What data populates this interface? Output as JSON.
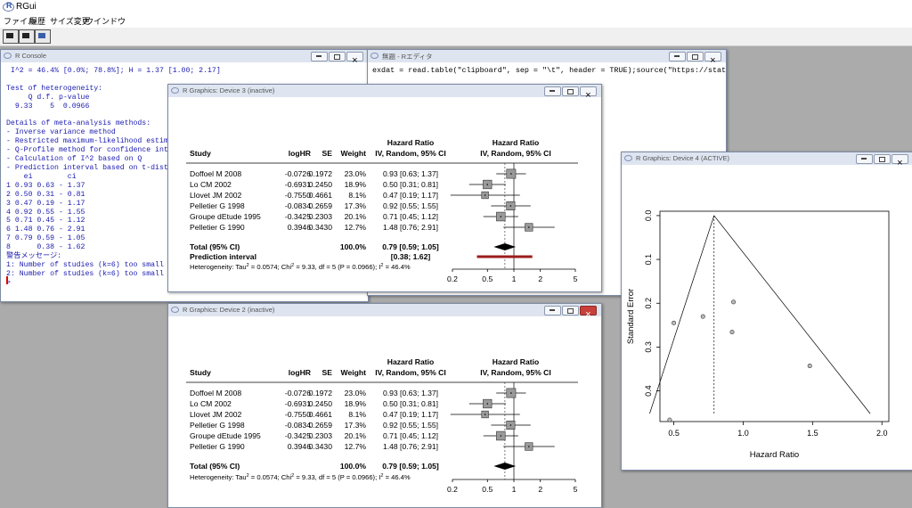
{
  "app": {
    "title": "RGui"
  },
  "menu": [
    "ファイル",
    "履歴",
    "サイズ変更",
    "ウインドウ"
  ],
  "toolbar": {
    "icons": [
      "open-script-icon",
      "print-icon",
      "console-icon"
    ]
  },
  "console": {
    "title": "R Console",
    "lines": [
      " I^2 = 46.4% [0.0%; 78.8%]; H = 1.37 [1.00; 2.17]",
      "",
      "Test of heterogeneity:",
      "     Q d.f. p-value",
      "  9.33    5  0.0966",
      "",
      "Details of meta-analysis methods:",
      "- Inverse variance method",
      "- Restricted maximum-likelihood estim",
      "- Q-Profile method for confidence int",
      "- Calculation of I^2 based on Q",
      "- Prediction interval based on t-dist",
      "    ei        ci",
      "1 0.93 0.63 - 1.37",
      "2 0.50 0.31 - 0.81",
      "3 0.47 0.19 - 1.17",
      "4 0.92 0.55 - 1.55",
      "5 0.71 0.45 - 1.12",
      "6 1.48 0.76 - 2.91",
      "7 0.79 0.59 - 1.05",
      "8      0.38 - 1.62",
      "警告メッセージ:",
      "1: Number of studies (k=6) too small",
      "2: Number of studies (k=6) too small",
      "> "
    ]
  },
  "editor": {
    "title": "無題 - Rエディタ",
    "code": "exdat = read.table(\"clipboard\", sep = \"\\t\", header = TRUE);source(\"https://stat.r"
  },
  "device3": {
    "title": "R Graphics: Device 3 (inactive)",
    "show_prediction": true,
    "het_prefix": "Heterogeneity: Tau",
    "het_mid": " = 0.0574; Chi",
    "het_end": " = 9.33, df = 5 (P = 0.0966); I",
    "het_tail": " = 46.4%",
    "sup": "2",
    "pred_label": "Prediction interval",
    "pred_ci": "[0.38; 1.62]",
    "pred_range": [
      0.38,
      1.62
    ]
  },
  "device2": {
    "title": "R Graphics: Device 2 (inactive)"
  },
  "forest": {
    "headers": {
      "study": "Study",
      "loghr": "logHR",
      "se": "SE",
      "weight": "Weight",
      "hr1": "Hazard Ratio",
      "hr2": "IV, Random, 95% CI",
      "hr3": "Hazard Ratio",
      "hr4": "IV, Random, 95% CI"
    },
    "studies": [
      {
        "study": "Doffoel M 2008",
        "loghr": "-0.0726",
        "se": "0.1972",
        "weight": "23.0%",
        "ci": "0.93 [0.63; 1.37]",
        "hr": 0.93,
        "lo": 0.63,
        "hi": 1.37,
        "w": 23.0
      },
      {
        "study": "Lo CM 2002",
        "loghr": "-0.6931",
        "se": "0.2450",
        "weight": "18.9%",
        "ci": "0.50 [0.31; 0.81]",
        "hr": 0.5,
        "lo": 0.31,
        "hi": 0.81,
        "w": 18.9
      },
      {
        "study": "Llovet JM 2002",
        "loghr": "-0.7550",
        "se": "0.4661",
        "weight": "8.1%",
        "ci": "0.47 [0.19; 1.17]",
        "hr": 0.47,
        "lo": 0.19,
        "hi": 1.17,
        "w": 8.1
      },
      {
        "study": "Pelletier G 1998",
        "loghr": "-0.0834",
        "se": "0.2659",
        "weight": "17.3%",
        "ci": "0.92 [0.55; 1.55]",
        "hr": 0.92,
        "lo": 0.55,
        "hi": 1.55,
        "w": 17.3
      },
      {
        "study": "Groupe dEtude 1995",
        "loghr": "-0.3425",
        "se": "0.2303",
        "weight": "20.1%",
        "ci": "0.71 [0.45; 1.12]",
        "hr": 0.71,
        "lo": 0.45,
        "hi": 1.12,
        "w": 20.1
      },
      {
        "study": "Pelletier G 1990",
        "loghr": "0.3946",
        "se": "0.3430",
        "weight": "12.7%",
        "ci": "1.48 [0.76; 2.91]",
        "hr": 1.48,
        "lo": 0.76,
        "hi": 2.91,
        "w": 12.7
      }
    ],
    "total": {
      "label": "Total (95% CI)",
      "weight": "100.0%",
      "ci": "0.79 [0.59; 1.05]",
      "hr": 0.79,
      "lo": 0.59,
      "hi": 1.05
    },
    "ticks": [
      "0.2",
      "0.5",
      "1",
      "2",
      "5"
    ],
    "tick_values": [
      0.2,
      0.5,
      1,
      2,
      5
    ]
  },
  "funnel": {
    "title": "R Graphics: Device 4 (ACTIVE)",
    "xlabel": "Hazard Ratio",
    "ylabel": "Standard Error",
    "xticks": [
      "0.5",
      "1.0",
      "1.5",
      "2.0"
    ],
    "yticks": [
      "0.0",
      "0.1",
      "0.2",
      "0.3",
      "0.4"
    ]
  },
  "chart_data": [
    {
      "type": "scatter",
      "title": "",
      "xlabel": "Hazard Ratio",
      "ylabel": "Standard Error",
      "xlim": [
        0.4,
        2.05
      ],
      "ylim": [
        0.0,
        0.47
      ],
      "y_reversed": true,
      "pooled_estimate": 0.79,
      "points": [
        {
          "x": 0.93,
          "y": 0.1972
        },
        {
          "x": 0.5,
          "y": 0.245
        },
        {
          "x": 0.47,
          "y": 0.4661
        },
        {
          "x": 0.92,
          "y": 0.2659
        },
        {
          "x": 0.71,
          "y": 0.2303
        },
        {
          "x": 1.48,
          "y": 0.343
        }
      ]
    }
  ]
}
